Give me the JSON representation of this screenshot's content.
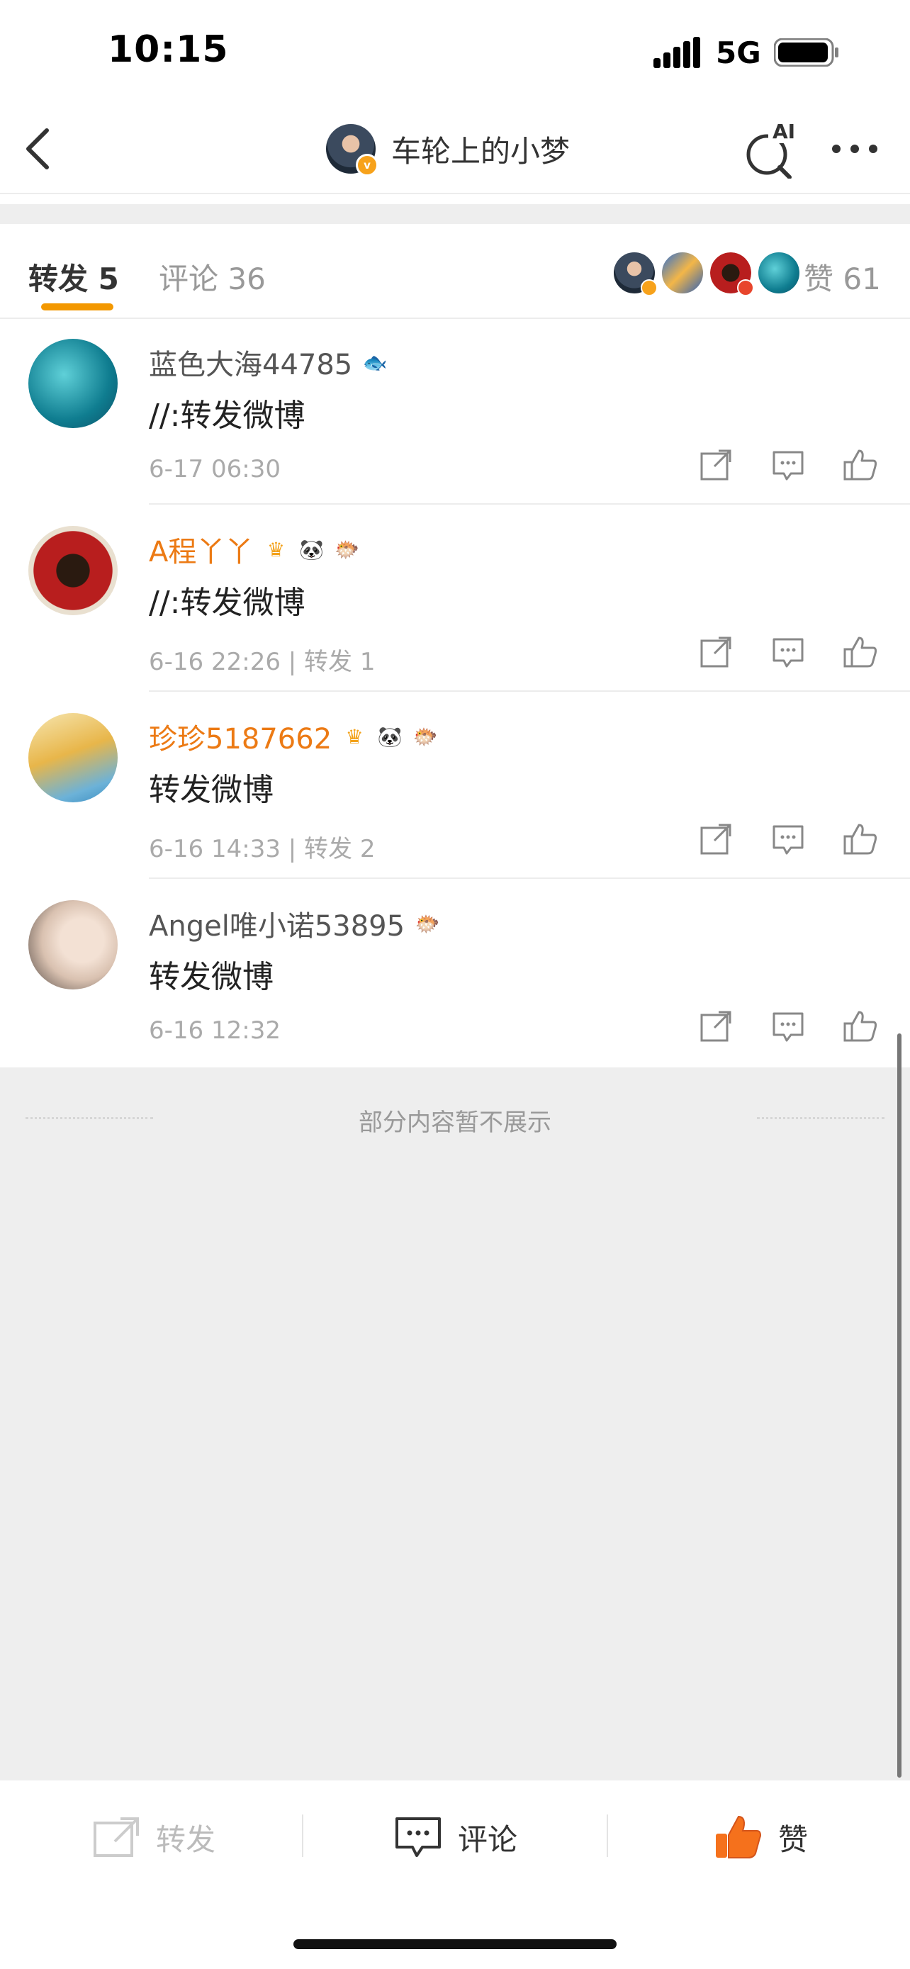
{
  "status_bar": {
    "time": "10:15",
    "network": "5G"
  },
  "nav": {
    "title": "车轮上的小梦",
    "ai_label": "AI"
  },
  "tabs": {
    "repost": {
      "label": "转发",
      "count": "5"
    },
    "comment": {
      "label": "评论",
      "count": "36"
    },
    "likes": {
      "label": "赞",
      "count": "61"
    }
  },
  "reposts": [
    {
      "name": "蓝色大海44785",
      "name_color": "gray",
      "text": "//:转发微博",
      "time": "6-17 06:30",
      "extra": ""
    },
    {
      "name": "A程丫丫",
      "name_color": "orange",
      "text": "//:转发微博",
      "time": "6-16 22:26",
      "extra": "| 转发 1"
    },
    {
      "name": "珍珍5187662",
      "name_color": "orange",
      "text": "转发微博",
      "time": "6-16 14:33",
      "extra": "| 转发 2"
    },
    {
      "name": "Angel唯小诺53895",
      "name_color": "gray",
      "text": "转发微博",
      "time": "6-16 12:32",
      "extra": ""
    }
  ],
  "hidden_note": "部分内容暂不展示",
  "bottom_bar": {
    "repost": "转发",
    "comment": "评论",
    "like": "赞"
  },
  "colors": {
    "accent": "#f39800",
    "orange_name": "#ec7a14",
    "like_active": "#f5711c"
  }
}
